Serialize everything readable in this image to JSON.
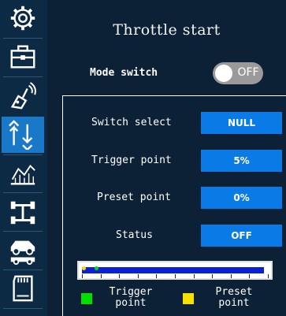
{
  "header": {
    "title": "Throttle start"
  },
  "mode_switch": {
    "label": "Mode switch",
    "state": "OFF"
  },
  "rows": [
    {
      "label": "Switch select",
      "value": "NULL"
    },
    {
      "label": "Trigger point",
      "value": "5%"
    },
    {
      "label": "Preset point",
      "value": "0%"
    },
    {
      "label": "Status",
      "value": "OFF"
    }
  ],
  "throttle_bar": {
    "fill_fraction": 0.98,
    "trigger_fraction": 0.05,
    "preset_fraction": 0.0
  },
  "legend": [
    {
      "label_line1": "Trigger",
      "label_line2": "point",
      "color": "#00e000"
    },
    {
      "label_line1": "Preset",
      "label_line2": "point",
      "color": "#f5e000"
    }
  ],
  "sidebar": {
    "items": [
      {
        "icon": "gear-icon"
      },
      {
        "icon": "toolbox-icon"
      },
      {
        "icon": "transmitter-icon"
      },
      {
        "icon": "up-down-arrows-icon",
        "active": true
      },
      {
        "icon": "chart-icon"
      },
      {
        "icon": "servo-icon"
      },
      {
        "icon": "car-icon"
      },
      {
        "icon": "sd-card-icon"
      }
    ]
  },
  "colors": {
    "accent": "#0a7be6",
    "sidebar_active": "#1a78c8",
    "background": "#0d2136"
  }
}
